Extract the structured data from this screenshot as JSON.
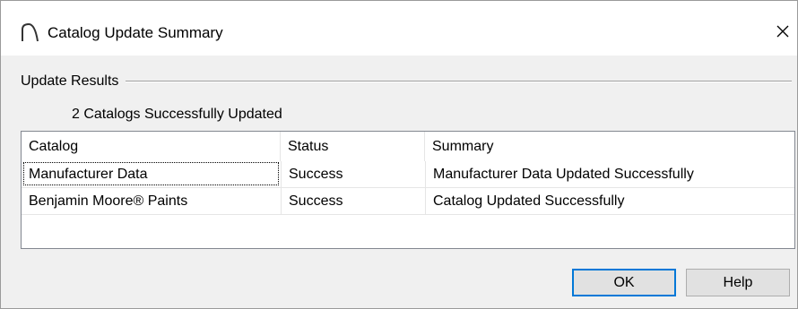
{
  "window": {
    "title": "Catalog Update Summary",
    "app_icon": "arch-icon",
    "close_icon": "close-icon"
  },
  "group": {
    "label": "Update Results",
    "summary_text": "2 Catalogs Successfully Updated"
  },
  "table": {
    "columns": [
      "Catalog",
      "Status",
      "Summary"
    ],
    "rows": [
      {
        "catalog": "Manufacturer Data",
        "status": "Success",
        "summary": "Manufacturer Data Updated Successfully"
      },
      {
        "catalog": "Benjamin Moore® Paints",
        "status": "Success",
        "summary": "Catalog Updated Successfully"
      }
    ]
  },
  "buttons": {
    "ok_label": "OK",
    "help_label": "Help"
  },
  "colors": {
    "dialog_background": "#f0f0f0",
    "default_button_border": "#0078d7",
    "list_border": "#828790"
  }
}
